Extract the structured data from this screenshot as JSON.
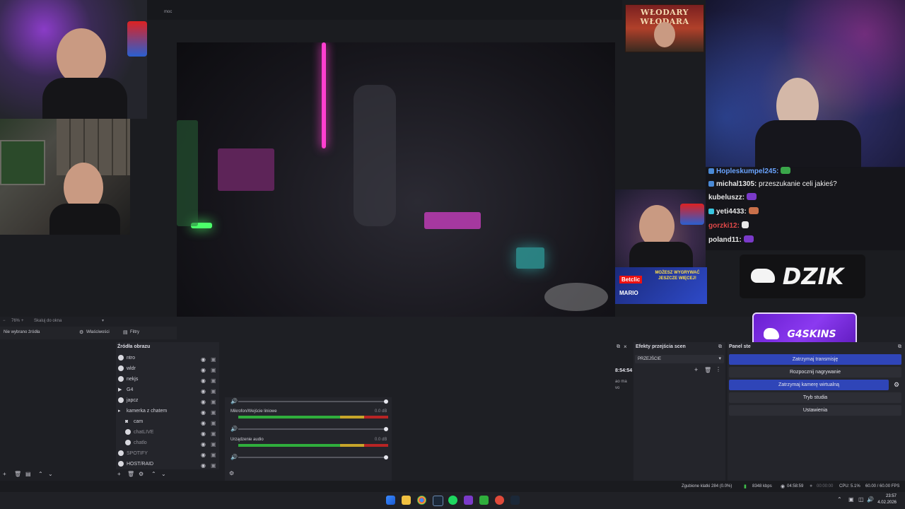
{
  "obs": {
    "menu_fragment": "moc",
    "zoom_level": "76%",
    "zoom_option": "Skaluj do okna",
    "no_source_selected": "Nie wybrano źródła",
    "properties_label": "Właściwości",
    "filters_label": "Filtry",
    "sources_title": "Źródła obrazu",
    "transitions_title": "Efekty przejścia scen",
    "transition_value": "PRZEJŚCIE",
    "controls_title": "Panel ste",
    "partial_timer": "8:54:54",
    "partial_text_1": "ao ma",
    "partial_text_2": "vo",
    "sources": [
      {
        "label": "ntro",
        "icon": "globe-icon"
      },
      {
        "label": "wldr",
        "icon": "globe-icon"
      },
      {
        "label": "nekjs",
        "icon": "globe-icon"
      },
      {
        "label": "G4",
        "icon": "play-icon"
      },
      {
        "label": "japcz",
        "icon": "globe-icon"
      },
      {
        "label": "kamerka z chatem",
        "icon": "folder-icon"
      },
      {
        "label": "cam",
        "icon": "camera-icon"
      },
      {
        "label": "chatLIVE",
        "icon": "globe-icon"
      },
      {
        "label": "chatlo",
        "icon": "globe-icon"
      },
      {
        "label": "SPOTIFY",
        "icon": "globe-icon"
      },
      {
        "label": "HOST/RAID",
        "icon": "globe-icon"
      }
    ],
    "mixer": [
      {
        "label": "Mikrofon/Wejście liniowe",
        "db": "0.0 dB"
      },
      {
        "label": "Urządzenie audio",
        "db": "0.0 dB"
      }
    ],
    "controls": [
      {
        "label": "Zatrzymaj transmisję",
        "active": true
      },
      {
        "label": "Rozpocznij nagrywanie",
        "active": false
      },
      {
        "label": "Zatrzymaj kamerę wirtualną",
        "active": true
      },
      {
        "label": "Tryb studia",
        "active": false
      },
      {
        "label": "Ustawienia",
        "active": false
      }
    ],
    "status": {
      "dropped_frames": "Zgubione klatki 284 (0.0%)",
      "bitrate": "8348 kbps",
      "live_time": "04:58:59",
      "rec_time": "00:00:00",
      "cpu": "CPU: 5.1%",
      "fps": "60.00 / 60.00 FPS"
    }
  },
  "overlay": {
    "poster_title": "WŁODARY WŁODARA",
    "brand_logo": "DZIK",
    "sponsor_logo": "G4SKINS",
    "betclic_label": "Betclic",
    "betclic_promo": "MOŻESZ WYGRYWAĆ JESZCZE WIĘCEJ!",
    "betclic_name": "MARIO",
    "chat": [
      {
        "user": "Hopleskumpel245:",
        "msg": "",
        "emote": true
      },
      {
        "user": "michal1305:",
        "msg": "przeszukanie celi jakieś?",
        "emote": false
      },
      {
        "user": "kubeluszz:",
        "msg": "",
        "emote": true
      },
      {
        "user": "yeti4433:",
        "msg": "",
        "emote": true
      },
      {
        "user": "gorzki12:",
        "msg": "",
        "emote": true
      },
      {
        "user": "poland11:",
        "msg": "",
        "emote": true
      }
    ]
  },
  "taskbar": {
    "time": "23:57",
    "date": "4.02.2026"
  },
  "colors": {
    "accent_blue": "#2f45b8",
    "sponsor_purple": "#7a2ae0",
    "neon_pink": "#ff3fd0",
    "neon_green": "#4cff6a",
    "neon_cyan": "#39e6e0"
  }
}
